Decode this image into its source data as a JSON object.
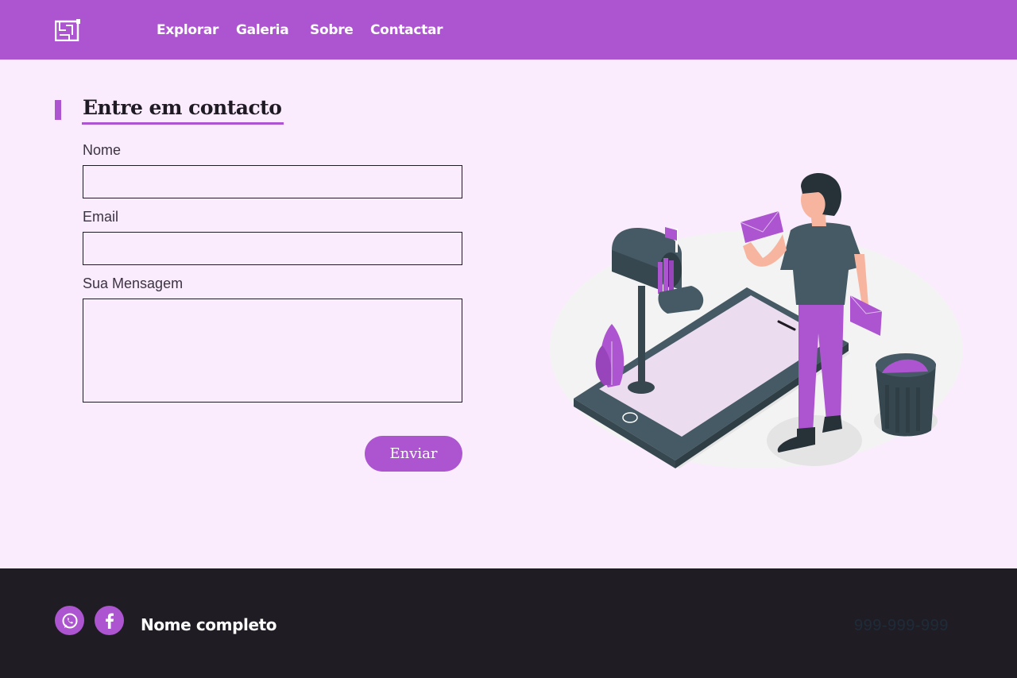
{
  "nav": {
    "logo_icon": "floorplan-icon",
    "links": [
      {
        "label": "Explorar"
      },
      {
        "label": "Galeria"
      },
      {
        "label": "Sobre"
      },
      {
        "label": "Contactar"
      }
    ]
  },
  "contact": {
    "title": "Entre em contacto",
    "name_label": "Nome",
    "name_value": "",
    "email_label": "Email",
    "email_value": "",
    "message_label": "Sua Mensagem",
    "message_value": "",
    "submit_label": "Enviar"
  },
  "illustration": {
    "icon": "mailbox-person-phone-illustration"
  },
  "footer": {
    "social": [
      {
        "icon": "whatsapp-icon"
      },
      {
        "icon": "facebook-icon"
      }
    ],
    "name": "Nome completo",
    "phone": "999-999-999"
  },
  "colors": {
    "accent": "#ad55d0",
    "background": "#fbecfd",
    "footer": "#201c24",
    "text": "#1f1b24"
  }
}
